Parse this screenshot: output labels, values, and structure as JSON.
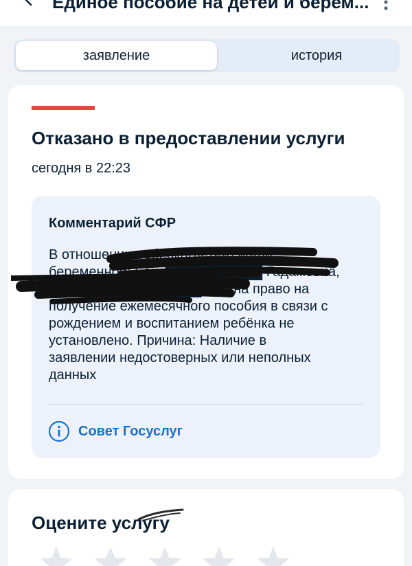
{
  "header": {
    "title": "Единое пособие на детей и берем..."
  },
  "tabs": [
    {
      "label": "заявление",
      "active": true
    },
    {
      "label": "история",
      "active": false
    }
  ],
  "status": {
    "accent_color": "#e2483d",
    "title": "Отказано в предоставлении услуги",
    "time": "сегодня в 22:23"
  },
  "comment": {
    "title": "Комментарий СФР",
    "lines": [
      "В отношении ребёнка(детей) и/или",
      "беременной: Бака██████████ Гадамовна,",
      "Ба██████████████амовна право на",
      "получение ежемесячного пособия в связи с",
      "рождением и воспитанием ребёнка не",
      "установлено. Причина: Наличие в",
      "заявлении недостоверных или неполных",
      "данных"
    ],
    "advice_label": "Совет Госуслуг",
    "advice_icon": "info-icon"
  },
  "rating": {
    "title": "Оцените услугу",
    "value": 0,
    "max": 5
  },
  "colors": {
    "link": "#1e6fc6",
    "background": "#f1f3f6",
    "comment_bg": "#edf2fa"
  }
}
